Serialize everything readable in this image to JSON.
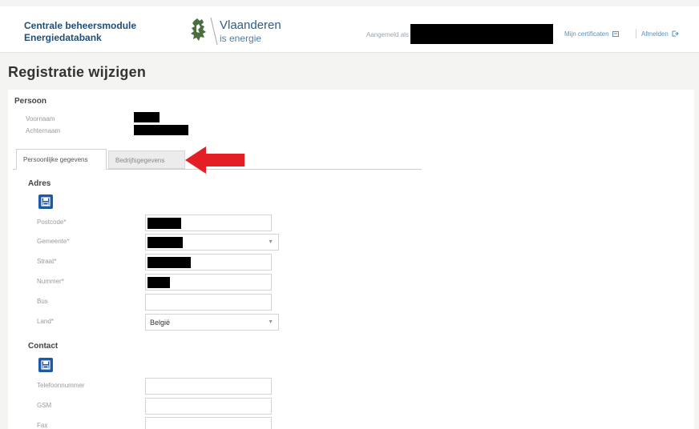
{
  "header": {
    "app_name_line1": "Centrale beheersmodule",
    "app_name_line2": "Energiedatabank",
    "brand_title": "Vlaanderen",
    "brand_subtitle": "is energie",
    "login_label": "Aangemeld als",
    "links": [
      {
        "label": "Mijn certificaten",
        "icon": "certificate-icon"
      },
      {
        "label": "Afmelden",
        "icon": "logout-icon"
      }
    ]
  },
  "page": {
    "title": "Registratie wijzigen"
  },
  "person": {
    "section_title": "Persoon",
    "fields": [
      {
        "label": "Voornaam"
      },
      {
        "label": "Achternaam"
      }
    ]
  },
  "tabs": [
    {
      "label": "Persoonlijke gegevens",
      "active": true
    },
    {
      "label": "Bedrijfsgegevens",
      "active": false
    }
  ],
  "address": {
    "section_title": "Adres",
    "fields": [
      {
        "label": "Postcode*",
        "value": "",
        "type": "input"
      },
      {
        "label": "Gemeente*",
        "value": "",
        "type": "select"
      },
      {
        "label": "Straat*",
        "value": "",
        "type": "input"
      },
      {
        "label": "Nummer*",
        "value": "",
        "type": "input"
      },
      {
        "label": "Bus",
        "value": "",
        "type": "input"
      },
      {
        "label": "Land*",
        "value": "België",
        "type": "select"
      }
    ]
  },
  "contact": {
    "section_title": "Contact",
    "fields": [
      {
        "label": "Telefoonnummer",
        "value": ""
      },
      {
        "label": "GSM",
        "value": ""
      },
      {
        "label": "Fax",
        "value": ""
      }
    ]
  },
  "annotation": {
    "arrow_color": "#e31e24"
  },
  "colors": {
    "primary": "#1d5aa3",
    "brand": "#1f4e79",
    "link": "#5d8fbf"
  },
  "icons": [
    "flanders-lion-icon",
    "certificate-icon",
    "logout-icon",
    "save-icon",
    "chevron-down-icon",
    "red-arrow-icon"
  ]
}
